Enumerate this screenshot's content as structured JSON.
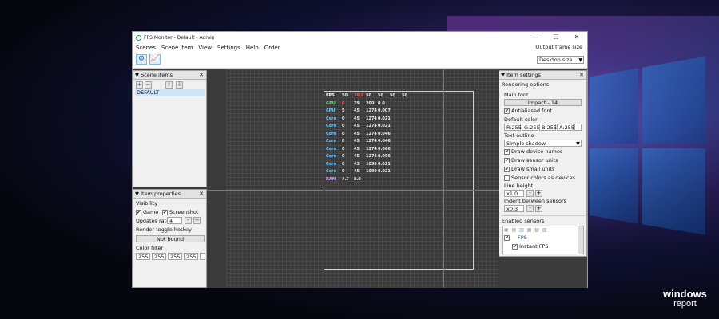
{
  "app": {
    "title": "FPS Monitor - Default - Admin",
    "window_buttons": {
      "minimize": "—",
      "maximize": "☐",
      "close": "✕"
    }
  },
  "menu": [
    "Scenes",
    "Scene item",
    "View",
    "Settings",
    "Help",
    "Order"
  ],
  "toolbar": {
    "output_frame_size_label": "Output frame size",
    "output_frame_size_value": "Desktop size"
  },
  "scene_items": {
    "header": "Scene items",
    "add": "+",
    "remove": "−",
    "up": "⬆",
    "down": "⬇",
    "items": [
      "DEFAULT"
    ]
  },
  "item_properties": {
    "header": "Item properties",
    "visibility_label": "Visibility",
    "game_label": "Game",
    "screenshot_label": "Screenshot",
    "updates_rate_label": "Updates rate",
    "updates_rate_value": "4",
    "minus": "-",
    "plus": "+",
    "render_toggle_label": "Render toggle hotkey",
    "hotkey_value": "Not bound",
    "color_filter_label": "Color filter",
    "color_filter_values": [
      "255",
      "255",
      "255",
      "255"
    ]
  },
  "item_settings": {
    "header": "Item settings",
    "rendering_options": "Rendering options",
    "main_font_label": "Main font",
    "main_font_value": "Impact - 14",
    "antialiased_label": "Antialiased font",
    "default_color_label": "Default color",
    "colors": [
      "R:255",
      "G:255",
      "B:255",
      "A:255"
    ],
    "text_outline_label": "Text outline",
    "text_outline_value": "Simple shadow",
    "draw_device_names": "Draw device names",
    "draw_sensor_units": "Draw sensor units",
    "draw_small_units": "Draw small units",
    "sensor_colors_as_devices": "Sensor colors as devices",
    "line_height_label": "Line height",
    "line_height_value": "x1.0",
    "indent_label": "Indent between sensors",
    "indent_value": "x0.3",
    "enabled_sensors_label": "Enabled sensors",
    "sensor_fps": "FPS",
    "sensor_instant_fps": "Instant FPS"
  },
  "overlay": {
    "rows": [
      {
        "label": "FPS",
        "values": [
          "50",
          "28.8",
          "50",
          "50",
          "50",
          "50"
        ]
      },
      {
        "label": "GPU",
        "values": [
          "0",
          "39",
          "200",
          "0.0"
        ]
      },
      {
        "label": "CPU",
        "values": [
          "5",
          "45",
          "1274",
          "0.007"
        ]
      },
      {
        "label": "Core",
        "values": [
          "0",
          "45",
          "1274",
          "0.021"
        ]
      },
      {
        "label": "Core",
        "values": [
          "0",
          "45",
          "1274",
          "0.021"
        ]
      },
      {
        "label": "Core",
        "values": [
          "0",
          "45",
          "1274",
          "0.046"
        ]
      },
      {
        "label": "Core",
        "values": [
          "0",
          "45",
          "1274",
          "0.046"
        ]
      },
      {
        "label": "Core",
        "values": [
          "0",
          "45",
          "1274",
          "0.066"
        ]
      },
      {
        "label": "Core",
        "values": [
          "0",
          "45",
          "1274",
          "0.096"
        ]
      },
      {
        "label": "Core",
        "values": [
          "0",
          "43",
          "1099",
          "0.021"
        ]
      },
      {
        "label": "Core",
        "values": [
          "0",
          "45",
          "1099",
          "0.021"
        ]
      },
      {
        "label": "RAM",
        "values": [
          "4.7",
          "8.0"
        ]
      }
    ]
  },
  "branding": {
    "line1": "windows",
    "line2": "report"
  }
}
